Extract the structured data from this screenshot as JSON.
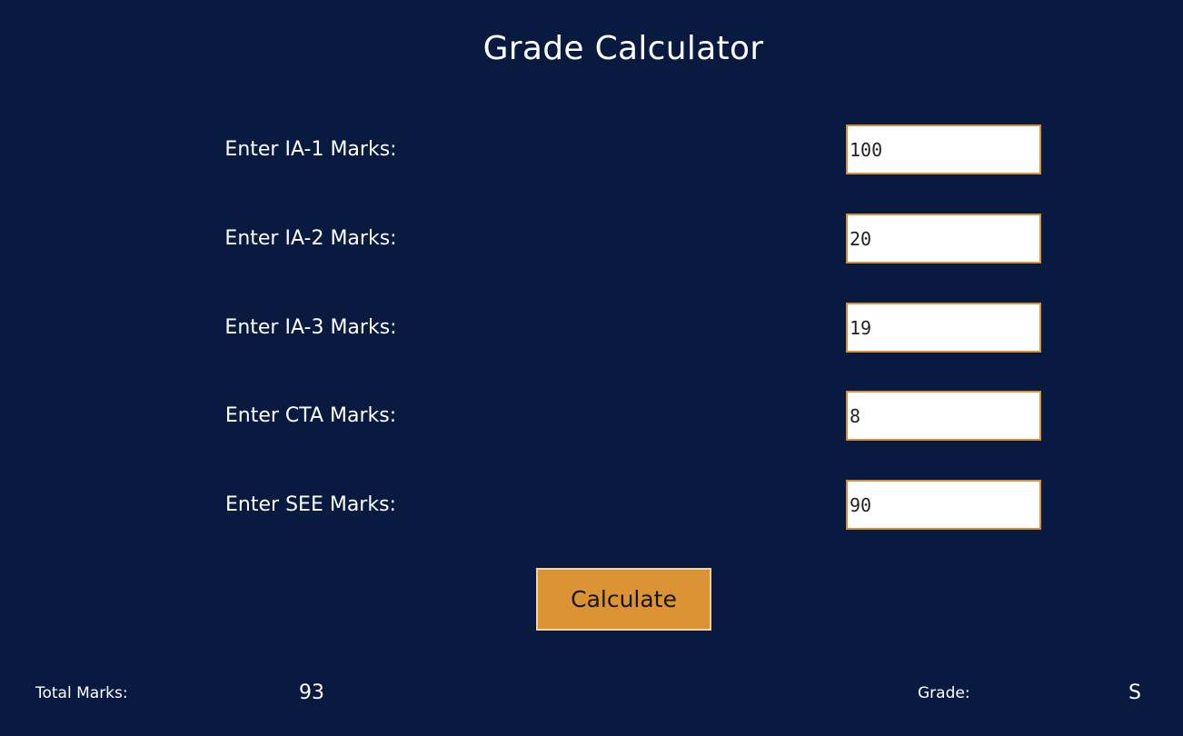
{
  "title": "Grade Calculator",
  "fields": [
    {
      "label": "Enter IA-1 Marks:",
      "value": "100"
    },
    {
      "label": "Enter IA-2 Marks:",
      "value": "20"
    },
    {
      "label": "Enter IA-3 Marks:",
      "value": "19"
    },
    {
      "label": "Enter CTA Marks:",
      "value": "8"
    },
    {
      "label": "Enter SEE Marks:",
      "value": "90"
    }
  ],
  "calculate_label": "Calculate",
  "results": {
    "total_label": "Total Marks:",
    "total_value": "93",
    "grade_label": "Grade:",
    "grade_value": "S"
  },
  "colors": {
    "background": "#081a3f",
    "accent": "#db9333",
    "field_border": "#d4903a"
  }
}
